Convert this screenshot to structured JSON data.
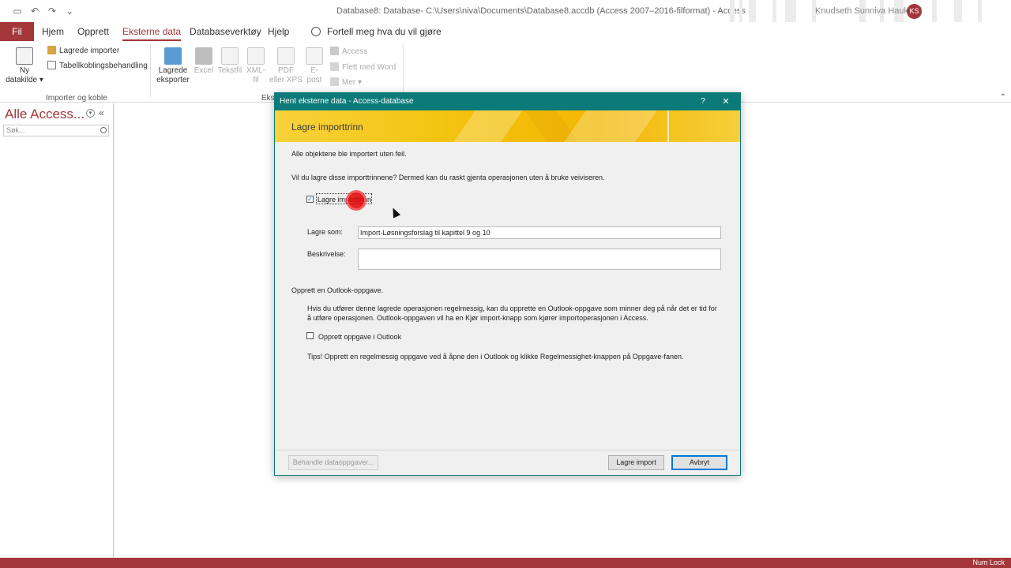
{
  "window": {
    "title": "Database8: Database- C:\\Users\\niva\\Documents\\Database8.accdb (Access 2007–2016-filformat)  -  Access",
    "user_name": "Knudseth Sunniva Haukelid",
    "user_initials": "KS"
  },
  "menu": {
    "file": "Fil",
    "tabs": [
      "Hjem",
      "Opprett",
      "Eksterne data",
      "Databaseverktøy",
      "Hjelp"
    ],
    "tell_me": "Fortell meg hva du vil gjøre"
  },
  "ribbon": {
    "new_source": {
      "line1": "Ny",
      "line2": "datakilde ▾"
    },
    "saved_imports": "Lagrede importer",
    "linked_table_manager": "Tabellkoblingsbehandling",
    "group_import": "Importer og koble",
    "saved_exports": {
      "line1": "Lagrede",
      "line2": "eksporter"
    },
    "excel": "Excel",
    "text_file": "Tekstfil",
    "xml_file": {
      "line1": "XML-",
      "line2": "fil"
    },
    "pdf_xps": {
      "line1": "PDF",
      "line2": "eller XPS"
    },
    "email": {
      "line1": "E-",
      "line2": "post"
    },
    "access": "Access",
    "word_merge": "Flett med Word",
    "more": "Mer ▾",
    "group_export": "Eksp"
  },
  "nav": {
    "title": "Alle Access...",
    "search_placeholder": "Søk..."
  },
  "dialog": {
    "title": "Hent eksterne data - Access-database",
    "help": "?",
    "close": "✕",
    "banner_title": "Lagre importtrinn",
    "success_msg": "Alle objektene ble importert uten feil.",
    "question": "Vil du lagre disse importtrinnene? Dermed kan du raskt gjenta operasjonen uten å bruke veiviseren.",
    "save_steps_label": "Lagre importtrinn",
    "save_as_label": "Lagre som:",
    "save_as_value": "Import-Løsningsforslag til kapittel 9 og 10",
    "description_label": "Beskrivelse:",
    "description_value": "",
    "outlook_heading": "Opprett en Outlook-oppgave.",
    "outlook_info": "Hvis du utfører denne lagrede operasjonen regelmessig, kan du opprette en Outlook-oppgave som minner deg på når det er tid for å utføre operasjonen. Outlook-oppgaven vil ha en Kjør import-knapp som kjører importoperasjonen i Access.",
    "create_task_label": "Opprett oppgave i Outlook",
    "tip": "Tips!  Opprett en regelmessig oppgave ved å åpne den i Outlook og klikke Regelmessighet-knappen på Oppgave-fanen.",
    "manage_tasks_btn": "Behandle dataoppgaver...",
    "save_import_btn": "Lagre import",
    "cancel_btn": "Avbryt"
  },
  "status": {
    "num_lock": "Num Lock"
  },
  "colors": {
    "accent": "#a4373a",
    "dialog_title": "#0b7a78",
    "banner": "#f4c20d"
  }
}
